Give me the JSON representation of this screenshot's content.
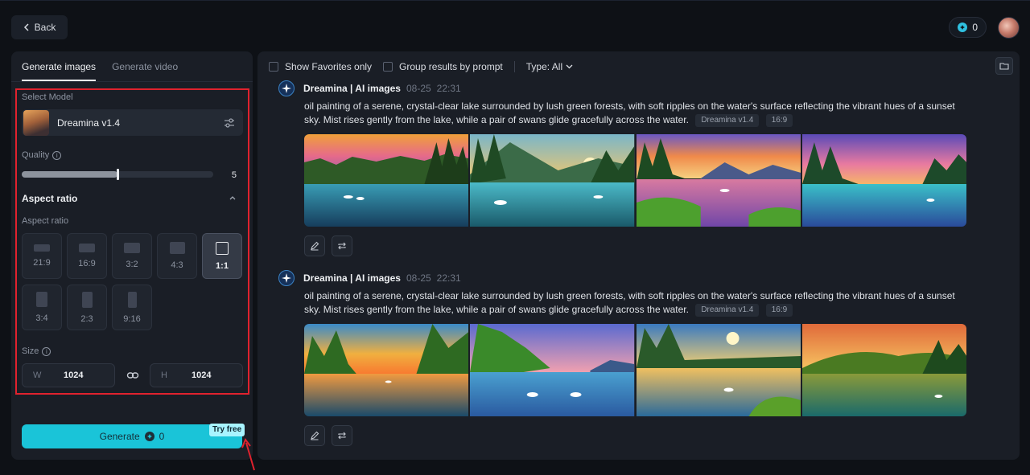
{
  "header": {
    "back_label": "Back",
    "credits": "0"
  },
  "left_panel": {
    "tabs": [
      {
        "label": "Generate images",
        "active": true
      },
      {
        "label": "Generate video",
        "active": false
      }
    ],
    "select_model_label": "Select Model",
    "model_name": "Dreamina v1.4",
    "quality_label": "Quality",
    "quality_value": "5",
    "quality_fraction": 0.5,
    "aspect_section_title": "Aspect ratio",
    "aspect_label": "Aspect ratio",
    "ratios": [
      {
        "label": "21:9"
      },
      {
        "label": "16:9"
      },
      {
        "label": "3:2"
      },
      {
        "label": "4:3"
      },
      {
        "label": "1:1",
        "active": true
      },
      {
        "label": "3:4"
      },
      {
        "label": "2:3"
      },
      {
        "label": "9:16"
      }
    ],
    "size_label": "Size",
    "width_prefix": "W",
    "width_value": "1024",
    "height_prefix": "H",
    "height_value": "1024",
    "generate_label": "Generate",
    "generate_cost": "0",
    "try_free_label": "Try free"
  },
  "filter_bar": {
    "favorites_label": "Show Favorites only",
    "group_label": "Group results by prompt",
    "type_label": "Type: All"
  },
  "results": [
    {
      "title": "Dreamina | AI images",
      "date": "08-25",
      "time": "22:31",
      "prompt": "oil painting of a serene, crystal-clear lake surrounded by lush green forests, with soft ripples on the water's surface reflecting the vibrant hues of a sunset sky. Mist rises gently from the lake, while a pair of swans glide gracefully across the water.",
      "model_tag": "Dreamina v1.4",
      "ratio_tag": "16:9"
    },
    {
      "title": "Dreamina | AI images",
      "date": "08-25",
      "time": "22:31",
      "prompt": "oil painting of a serene, crystal-clear lake surrounded by lush green forests, with soft ripples on the water's surface reflecting the vibrant hues of a sunset sky. Mist rises gently from the lake, while a pair of swans glide gracefully across the water.",
      "model_tag": "Dreamina v1.4",
      "ratio_tag": "16:9"
    }
  ],
  "colors": {
    "accent": "#1ac4d8",
    "highlight_border": "#e0222e",
    "background": "#0e1116",
    "panel": "#1a1e26"
  }
}
